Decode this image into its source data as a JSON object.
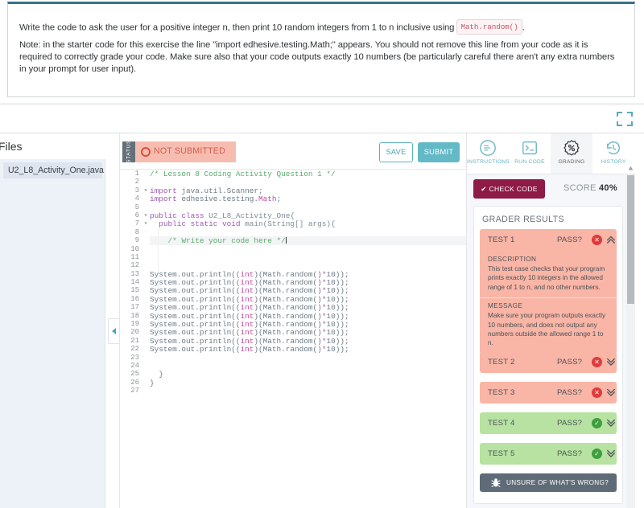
{
  "prompt": {
    "line1_before": "Write the code to ask the user for a positive integer n, then print 10 random integers from 1 to n inclusive using ",
    "line1_code": "Math.random()",
    "line1_after": ".",
    "line2": "Note: in the starter code for this exercise the line \"import edhesive.testing.Math;\" appears. You should not remove this line from your code as it is required to correctly grade your code. Make sure also that your code outputs exactly 10 numbers (be particularly careful there aren't any extra numbers in your prompt for user input)."
  },
  "files": {
    "title": "Files",
    "items": [
      {
        "label": "U2_L8_Activity_One.java"
      }
    ]
  },
  "editor": {
    "status_tag": "STATUS",
    "status_text": "NOT SUBMITTED",
    "save_label": "SAVE",
    "submit_label": "SUBMIT",
    "lines": [
      {
        "n": "1",
        "fold": "",
        "segs": [
          {
            "t": "/* Lesson 8 Coding Activity Question 1 */",
            "c": "k-com"
          }
        ]
      },
      {
        "n": "2",
        "fold": "",
        "segs": []
      },
      {
        "n": "3",
        "fold": "▾",
        "segs": [
          {
            "t": "import",
            "c": "k-kw"
          },
          {
            "t": " java.util.Scanner;",
            "c": "k-id"
          }
        ]
      },
      {
        "n": "4",
        "fold": "",
        "segs": [
          {
            "t": "import",
            "c": "k-kw"
          },
          {
            "t": " edhesive.testing.",
            "c": "k-id"
          },
          {
            "t": "Math",
            "c": "k-type"
          },
          {
            "t": ";",
            "c": "k-id"
          }
        ]
      },
      {
        "n": "5",
        "fold": "",
        "segs": []
      },
      {
        "n": "6",
        "fold": "▾",
        "segs": [
          {
            "t": "public class ",
            "c": "k-kw"
          },
          {
            "t": "U2_L8_Activity_One{",
            "c": "k-cls"
          }
        ]
      },
      {
        "n": "7",
        "fold": "▾",
        "segs": [
          {
            "t": "  public static void ",
            "c": "k-kw"
          },
          {
            "t": "main(String[] args){",
            "c": "k-cls"
          }
        ]
      },
      {
        "n": "8",
        "fold": "",
        "segs": []
      },
      {
        "n": "9",
        "fold": "",
        "hl": true,
        "caret": true,
        "segs": [
          {
            "t": "    /* Write your code here */",
            "c": "k-com"
          }
        ]
      },
      {
        "n": "10",
        "fold": "",
        "segs": []
      },
      {
        "n": "11",
        "fold": "",
        "segs": []
      },
      {
        "n": "12",
        "fold": "",
        "segs": []
      },
      {
        "n": "13",
        "fold": "",
        "segs": [
          {
            "t": "System.out.println((",
            "c": "k-id"
          },
          {
            "t": "int",
            "c": "k-type"
          },
          {
            "t": ")(Math.random()",
            "c": "k-id"
          },
          {
            "t": "*",
            "c": "k-pink"
          },
          {
            "t": "10));",
            "c": "k-id"
          }
        ]
      },
      {
        "n": "14",
        "fold": "",
        "segs": [
          {
            "t": "System.out.println((",
            "c": "k-id"
          },
          {
            "t": "int",
            "c": "k-type"
          },
          {
            "t": ")(Math.random()",
            "c": "k-id"
          },
          {
            "t": "*",
            "c": "k-pink"
          },
          {
            "t": "10));",
            "c": "k-id"
          }
        ]
      },
      {
        "n": "15",
        "fold": "",
        "segs": [
          {
            "t": "System.out.println((",
            "c": "k-id"
          },
          {
            "t": "int",
            "c": "k-type"
          },
          {
            "t": ")(Math.random()",
            "c": "k-id"
          },
          {
            "t": "*",
            "c": "k-pink"
          },
          {
            "t": "10));",
            "c": "k-id"
          }
        ]
      },
      {
        "n": "16",
        "fold": "",
        "segs": [
          {
            "t": "System.out.println((",
            "c": "k-id"
          },
          {
            "t": "int",
            "c": "k-type"
          },
          {
            "t": ")(Math.random()",
            "c": "k-id"
          },
          {
            "t": "*",
            "c": "k-pink"
          },
          {
            "t": "10));",
            "c": "k-id"
          }
        ]
      },
      {
        "n": "17",
        "fold": "",
        "segs": [
          {
            "t": "System.out.println((",
            "c": "k-id"
          },
          {
            "t": "int",
            "c": "k-type"
          },
          {
            "t": ")(Math.random()",
            "c": "k-id"
          },
          {
            "t": "*",
            "c": "k-pink"
          },
          {
            "t": "10));",
            "c": "k-id"
          }
        ]
      },
      {
        "n": "18",
        "fold": "",
        "segs": [
          {
            "t": "System.out.println((",
            "c": "k-id"
          },
          {
            "t": "int",
            "c": "k-type"
          },
          {
            "t": ")(Math.random()",
            "c": "k-id"
          },
          {
            "t": "*",
            "c": "k-pink"
          },
          {
            "t": "10));",
            "c": "k-id"
          }
        ]
      },
      {
        "n": "19",
        "fold": "",
        "segs": [
          {
            "t": "System.out.println((",
            "c": "k-id"
          },
          {
            "t": "int",
            "c": "k-type"
          },
          {
            "t": ")(Math.random()",
            "c": "k-id"
          },
          {
            "t": "*",
            "c": "k-pink"
          },
          {
            "t": "10));",
            "c": "k-id"
          }
        ]
      },
      {
        "n": "20",
        "fold": "",
        "segs": [
          {
            "t": "System.out.println((",
            "c": "k-id"
          },
          {
            "t": "int",
            "c": "k-type"
          },
          {
            "t": ")(Math.random()",
            "c": "k-id"
          },
          {
            "t": "*",
            "c": "k-pink"
          },
          {
            "t": "10));",
            "c": "k-id"
          }
        ]
      },
      {
        "n": "21",
        "fold": "",
        "segs": [
          {
            "t": "System.out.println((",
            "c": "k-id"
          },
          {
            "t": "int",
            "c": "k-type"
          },
          {
            "t": ")(Math.random()",
            "c": "k-id"
          },
          {
            "t": "*",
            "c": "k-pink"
          },
          {
            "t": "10));",
            "c": "k-id"
          }
        ]
      },
      {
        "n": "22",
        "fold": "",
        "segs": [
          {
            "t": "System.out.println((",
            "c": "k-id"
          },
          {
            "t": "int",
            "c": "k-type"
          },
          {
            "t": ")(Math.random()",
            "c": "k-id"
          },
          {
            "t": "*",
            "c": "k-pink"
          },
          {
            "t": "10));",
            "c": "k-id"
          }
        ]
      },
      {
        "n": "23",
        "fold": "",
        "segs": []
      },
      {
        "n": "24",
        "fold": "",
        "segs": []
      },
      {
        "n": "25",
        "fold": "",
        "segs": [
          {
            "t": "  }",
            "c": "k-id"
          }
        ]
      },
      {
        "n": "26",
        "fold": "",
        "segs": [
          {
            "t": "}",
            "c": "k-id"
          }
        ]
      },
      {
        "n": "27",
        "fold": "",
        "segs": []
      }
    ]
  },
  "panel": {
    "tabs": [
      {
        "label": "INSTRUCTIONS",
        "icon": "instructions-icon",
        "active": false
      },
      {
        "label": "RUN CODE",
        "icon": "terminal-icon",
        "active": false
      },
      {
        "label": "GRADING",
        "icon": "percent-badge-icon",
        "active": true
      },
      {
        "label": "HISTORY",
        "icon": "clock-rewind-icon",
        "active": false
      }
    ],
    "check_code_label": "CHECK CODE",
    "score_label": "SCORE",
    "score_value": "40%",
    "results_title": "GRADER RESULTS",
    "tests": [
      {
        "name": "TEST 1",
        "verdict": "PASS?",
        "status": "fail",
        "expanded": true,
        "description_label": "DESCRIPTION",
        "description": "This test case checks that your program prints exactly 10 integers in the allowed range of 1 to n, and no other numbers.",
        "message_label": "MESSAGE",
        "message": "Make sure your program outputs exactly 10 numbers, and does not output any numbers outside the allowed range 1 to n."
      },
      {
        "name": "TEST 2",
        "verdict": "PASS?",
        "status": "fail",
        "expanded": false
      },
      {
        "name": "TEST 3",
        "verdict": "PASS?",
        "status": "fail",
        "expanded": false
      },
      {
        "name": "TEST 4",
        "verdict": "PASS?",
        "status": "pass",
        "expanded": false
      },
      {
        "name": "TEST 5",
        "verdict": "PASS?",
        "status": "pass",
        "expanded": false
      }
    ],
    "unsure_label": "UNSURE OF WHAT'S WRONG?"
  },
  "colors": {
    "fail": "#f9b5a6",
    "pass": "#b7e2a1",
    "accent_teal": "#63b9c6",
    "maroon": "#8e1a46",
    "status_bg": "#f7bcb0"
  }
}
